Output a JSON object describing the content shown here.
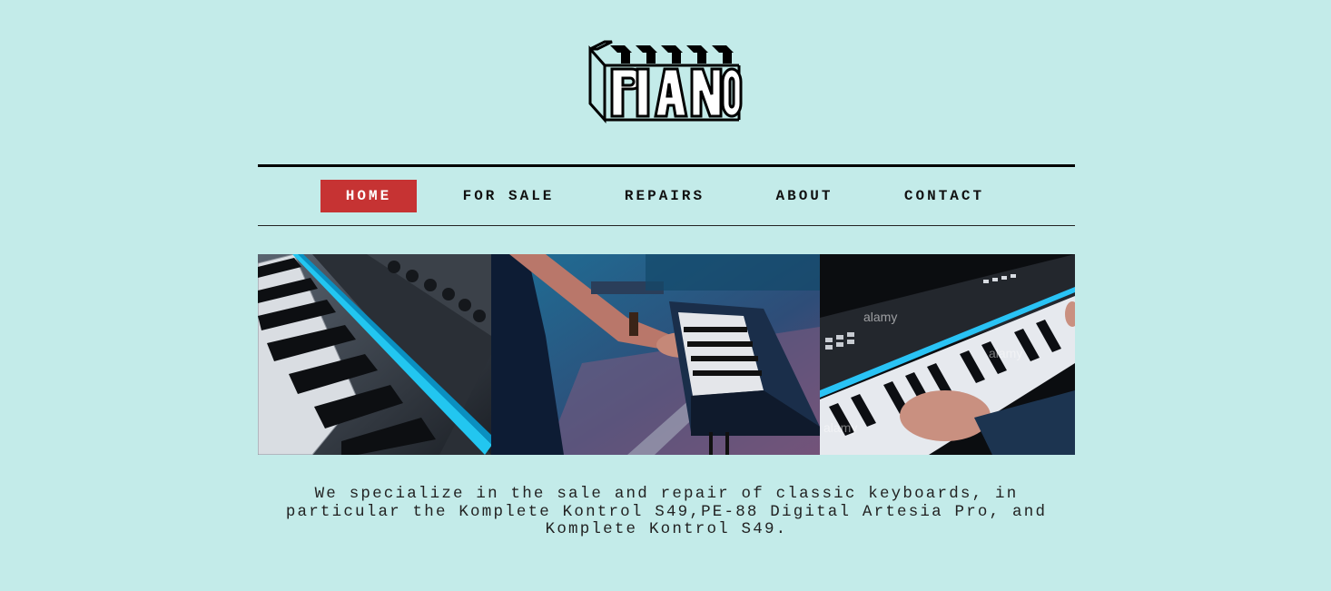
{
  "logo": {
    "text": "PIANO"
  },
  "nav": {
    "items": [
      {
        "label": "HOME",
        "active": true
      },
      {
        "label": "FOR SALE",
        "active": false
      },
      {
        "label": "REPAIRS",
        "active": false
      },
      {
        "label": "ABOUT",
        "active": false
      },
      {
        "label": "CONTACT",
        "active": false
      }
    ]
  },
  "gallery": {
    "photos": [
      {
        "subject": "keyboard-closeup-blue-light"
      },
      {
        "subject": "musician-playing-stage-keyboard"
      },
      {
        "subject": "hands-on-midi-controller"
      }
    ],
    "watermark": "alamy"
  },
  "intro": {
    "line1": "We specialize in the sale and repair of classic keyboards, in",
    "line2": "particular the Komplete Kontrol S49,PE-88 Digital Artesia Pro, and",
    "line3": "Komplete Kontrol S49."
  },
  "colors": {
    "background": "#c3ebe9",
    "accent": "#c63333",
    "text": "#111111"
  }
}
